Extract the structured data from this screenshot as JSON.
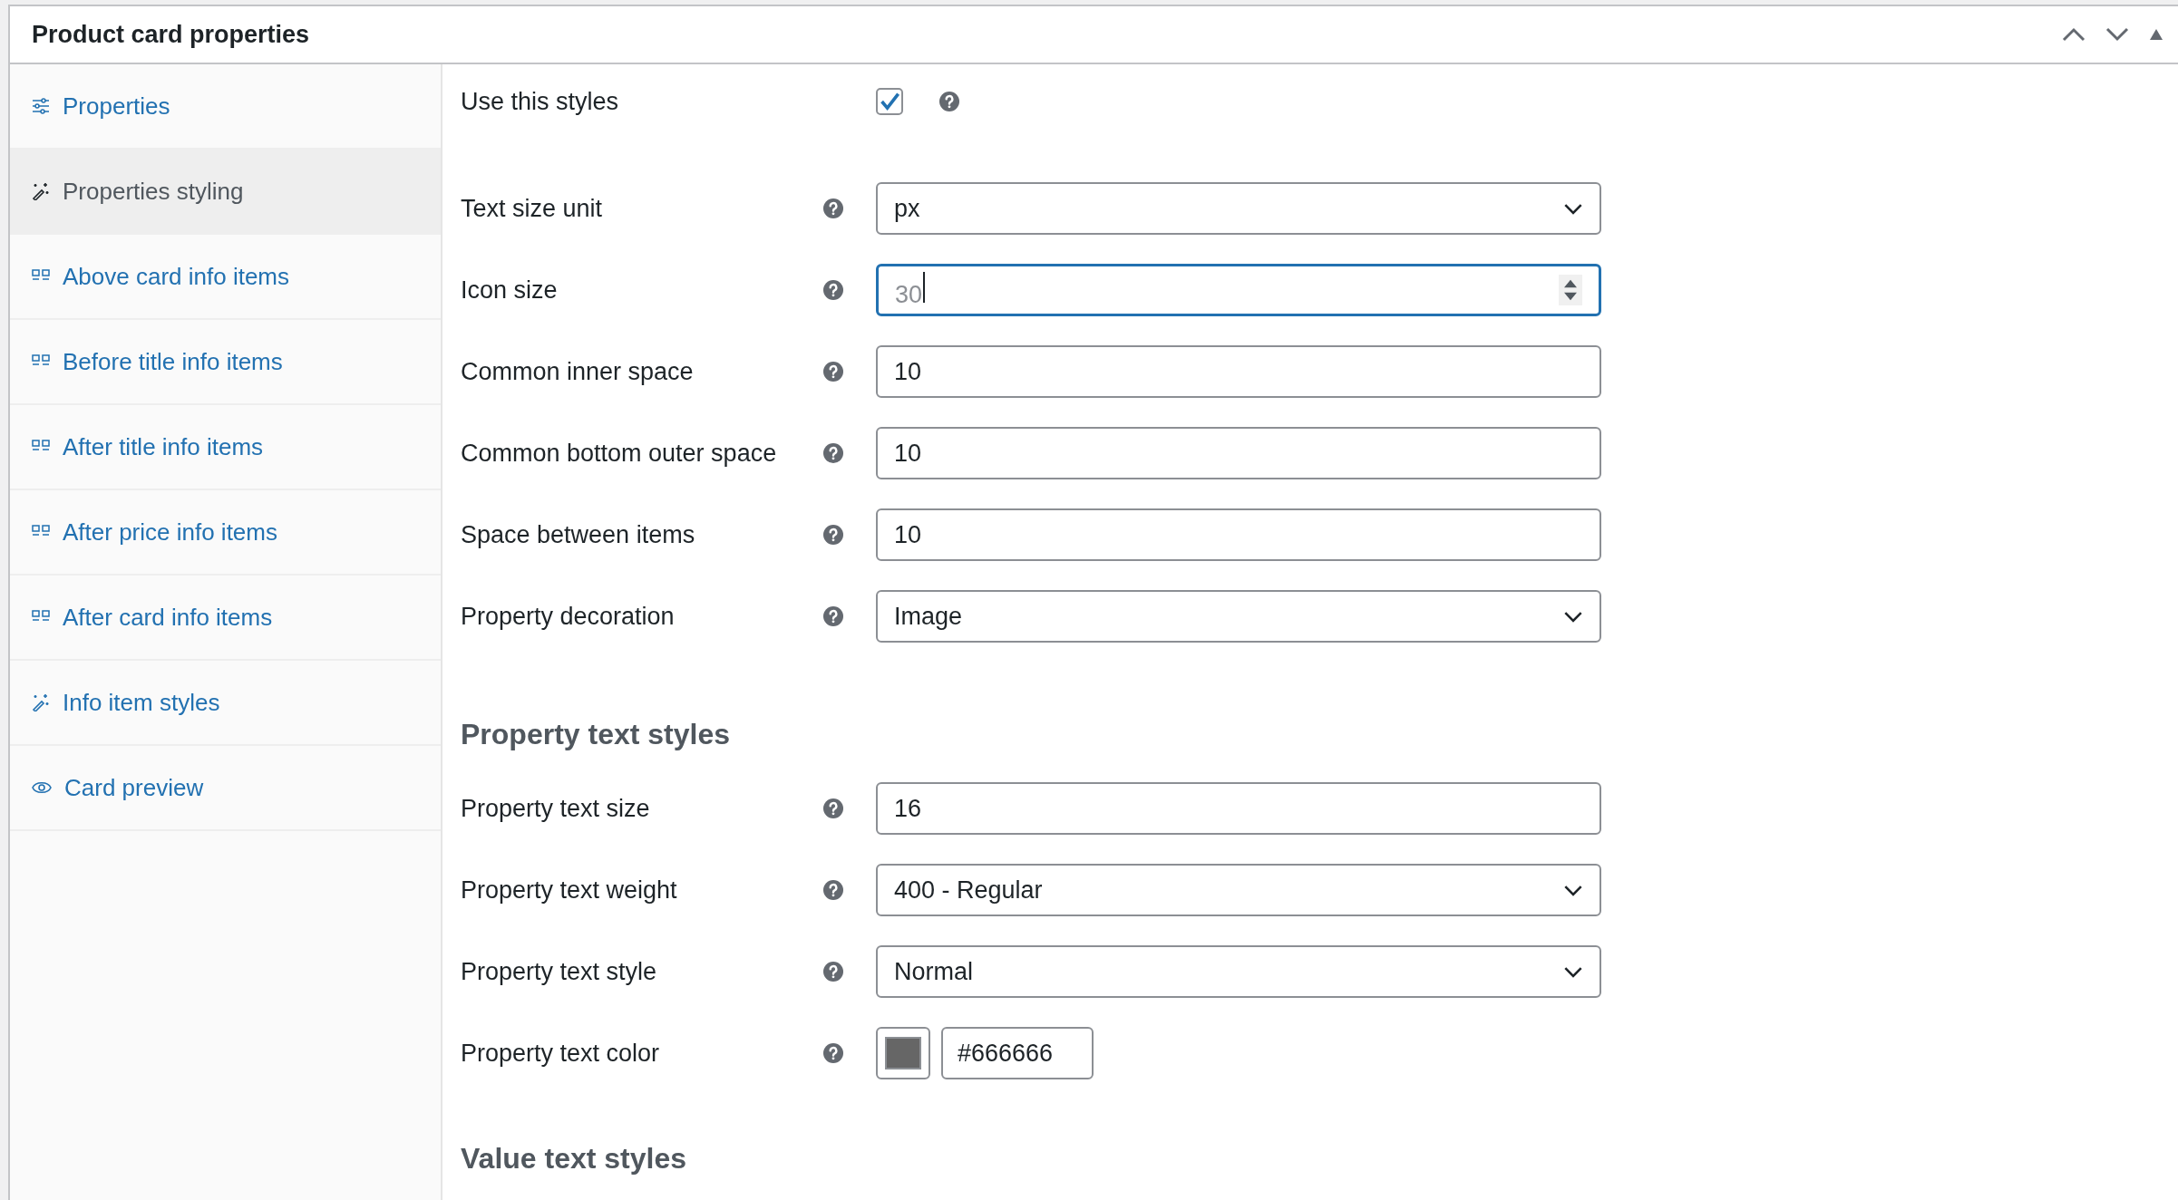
{
  "panel": {
    "title": "Product card properties"
  },
  "sidebar": {
    "items": [
      {
        "label": "Properties",
        "kind": "sliders",
        "selected": false
      },
      {
        "label": "Properties styling",
        "kind": "wand",
        "selected": true
      },
      {
        "label": "Above card info items",
        "kind": "grid",
        "selected": false
      },
      {
        "label": "Before title info items",
        "kind": "grid",
        "selected": false
      },
      {
        "label": "After title info items",
        "kind": "grid",
        "selected": false
      },
      {
        "label": "After price info items",
        "kind": "grid",
        "selected": false
      },
      {
        "label": "After card info items",
        "kind": "grid",
        "selected": false
      },
      {
        "label": "Info item styles",
        "kind": "wand",
        "selected": false
      },
      {
        "label": "Card preview",
        "kind": "eye",
        "selected": false
      }
    ]
  },
  "sections": [
    {
      "rows": [
        {
          "label": "Use this styles",
          "kind": "checkbox",
          "checked": true
        },
        {
          "label": "Text size unit",
          "kind": "select",
          "value": "px"
        },
        {
          "label": "Icon size",
          "kind": "number",
          "value": "30",
          "focused": true
        },
        {
          "label": "Common inner space",
          "kind": "text",
          "value": "10"
        },
        {
          "label": "Common bottom outer space",
          "kind": "text",
          "value": "10"
        },
        {
          "label": "Space between items",
          "kind": "text",
          "value": "10"
        },
        {
          "label": "Property decoration",
          "kind": "select",
          "value": "Image"
        }
      ]
    },
    {
      "heading": "Property text styles",
      "rows": [
        {
          "label": "Property text size",
          "kind": "text",
          "value": "16"
        },
        {
          "label": "Property text weight",
          "kind": "select",
          "value": "400 - Regular"
        },
        {
          "label": "Property text style",
          "kind": "select",
          "value": "Normal"
        },
        {
          "label": "Property text color",
          "kind": "color",
          "value": "#666666"
        }
      ]
    },
    {
      "heading": "Value text styles"
    }
  ]
}
